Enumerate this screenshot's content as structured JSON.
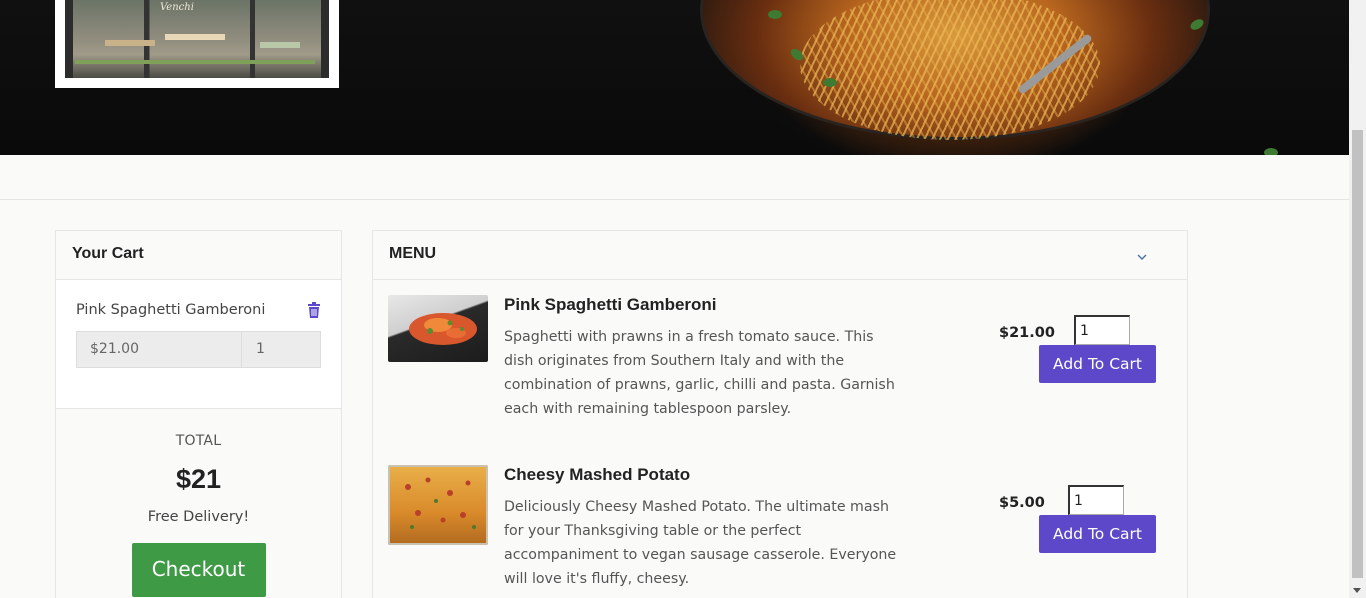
{
  "hero": {
    "storefront_sign": "Venchi"
  },
  "cart": {
    "title": "Your Cart",
    "items": [
      {
        "name": "Pink Spaghetti Gamberoni",
        "price": "$21.00",
        "quantity": "1"
      }
    ],
    "total_label": "TOTAL",
    "total_value": "$21",
    "delivery_text": "Free Delivery!",
    "checkout_label": "Checkout"
  },
  "menu": {
    "title": "MENU",
    "items": [
      {
        "name": "Pink Spaghetti Gamberoni",
        "description": "Spaghetti with prawns in a fresh tomato sauce. This dish originates from Southern Italy and with the combination of prawns, garlic, chilli and pasta. Garnish each with remaining tablespoon parsley.",
        "price": "$21.00",
        "quantity": "1",
        "add_label": "Add To Cart"
      },
      {
        "name": "Cheesy Mashed Potato",
        "description": "Deliciously Cheesy Mashed Potato. The ultimate mash for your Thanksgiving table or the perfect accompaniment to vegan sausage casserole. Everyone will love it's fluffy, cheesy.",
        "price": "$5.00",
        "quantity": "1",
        "add_label": "Add To Cart"
      }
    ]
  },
  "colors": {
    "accent_purple": "#5c48c8",
    "checkout_green": "#3f9a45",
    "trash_icon": "#5c48c8"
  },
  "icons": {
    "cart_remove": "trash-icon",
    "menu_toggle": "chevron-down-icon"
  }
}
